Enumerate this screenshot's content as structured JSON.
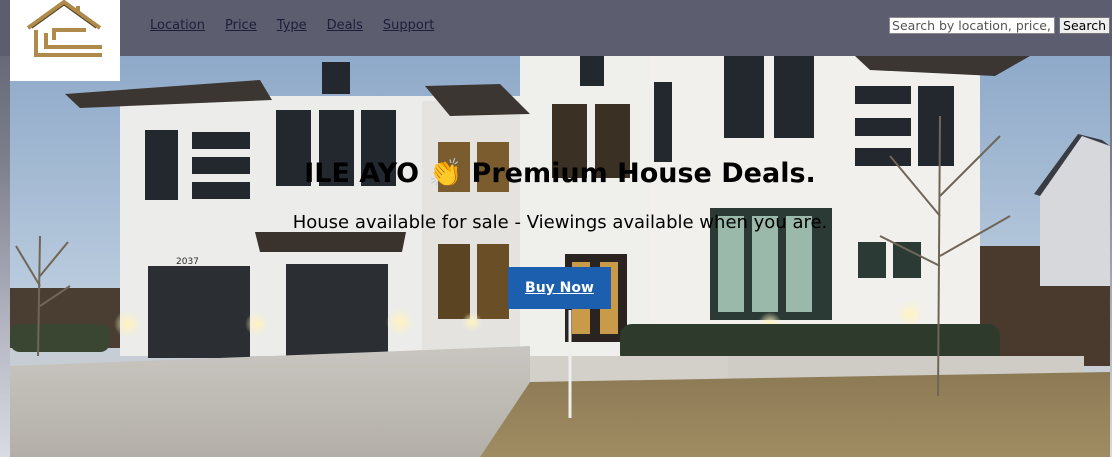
{
  "header": {
    "nav": [
      {
        "label": "Location"
      },
      {
        "label": "Price"
      },
      {
        "label": "Type"
      },
      {
        "label": "Deals"
      },
      {
        "label": "Support"
      }
    ],
    "search": {
      "placeholder": "Search by location, price, or type",
      "button_label": "Search"
    }
  },
  "hero": {
    "title": "ILE AYO 👏 Premium House Deals.",
    "subtitle": "House available for sale - Viewings available when you are.",
    "cta_label": "Buy Now",
    "house_number": "2037"
  },
  "colors": {
    "header_bg": "#5c5d6e",
    "cta_bg": "#1b5fae",
    "logo_gold": "#b08a4a"
  },
  "icons": {
    "logo": "house-logo-icon"
  }
}
